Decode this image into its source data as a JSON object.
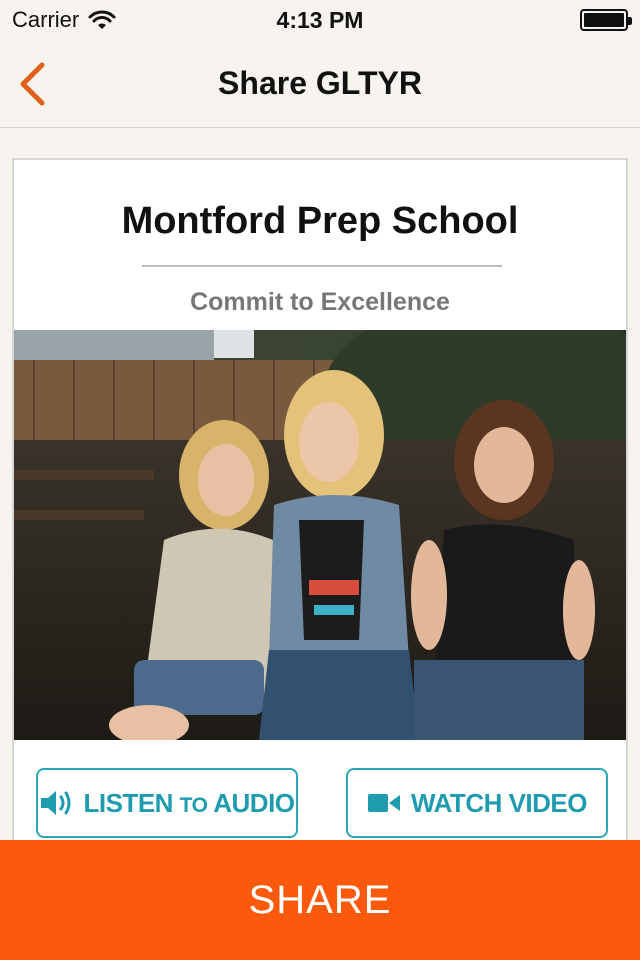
{
  "status_bar": {
    "carrier": "Carrier",
    "time": "4:13 PM"
  },
  "nav": {
    "title": "Share GLTYR",
    "back_icon": "chevron-left-icon"
  },
  "card": {
    "school_name": "Montford Prep School",
    "tagline": "Commit to Excellence",
    "photo_icon": "group-photo"
  },
  "actions": {
    "audio": {
      "icon": "speaker-icon",
      "label_main": "LISTEN",
      "label_small": "TO",
      "label_end": "AUDIO"
    },
    "video": {
      "icon": "video-camera-icon",
      "label": "WATCH VIDEO"
    }
  },
  "share": {
    "label": "SHARE"
  },
  "colors": {
    "accent": "#fb5a0c",
    "teal": "#1f9bb0",
    "back": "#e0621a"
  }
}
